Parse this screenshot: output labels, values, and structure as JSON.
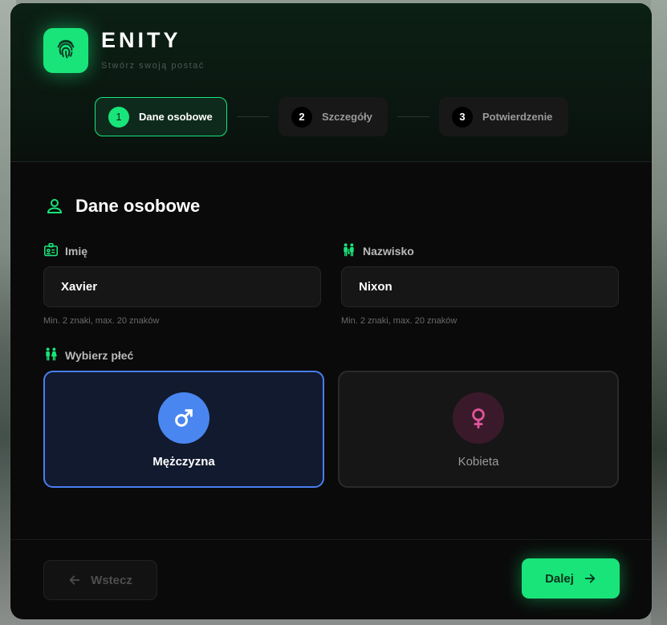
{
  "brand": {
    "title": "ENITY",
    "subtitle": "Stwórz swoją postać"
  },
  "steps": [
    {
      "num": "1",
      "label": "Dane osobowe",
      "active": true
    },
    {
      "num": "2",
      "label": "Szczegóły",
      "active": false
    },
    {
      "num": "3",
      "label": "Potwierdzenie",
      "active": false
    }
  ],
  "section": {
    "title": "Dane osobowe"
  },
  "fields": {
    "first_name": {
      "label": "Imię",
      "value": "Xavier",
      "hint": "Min. 2 znaki, max. 20 znaków"
    },
    "last_name": {
      "label": "Nazwisko",
      "value": "Nixon",
      "hint": "Min. 2 znaki, max. 20 znaków"
    }
  },
  "gender": {
    "label": "Wybierz płeć",
    "options": [
      {
        "label": "Mężczyzna",
        "icon": "male-icon",
        "selected": true
      },
      {
        "label": "Kobieta",
        "icon": "female-icon",
        "selected": false
      }
    ]
  },
  "buttons": {
    "back": "Wstecz",
    "next": "Dalej"
  },
  "colors": {
    "accent": "#19e47a",
    "male": "#4a86f0",
    "female": "#e0559c",
    "background": "#0a0a0a"
  }
}
